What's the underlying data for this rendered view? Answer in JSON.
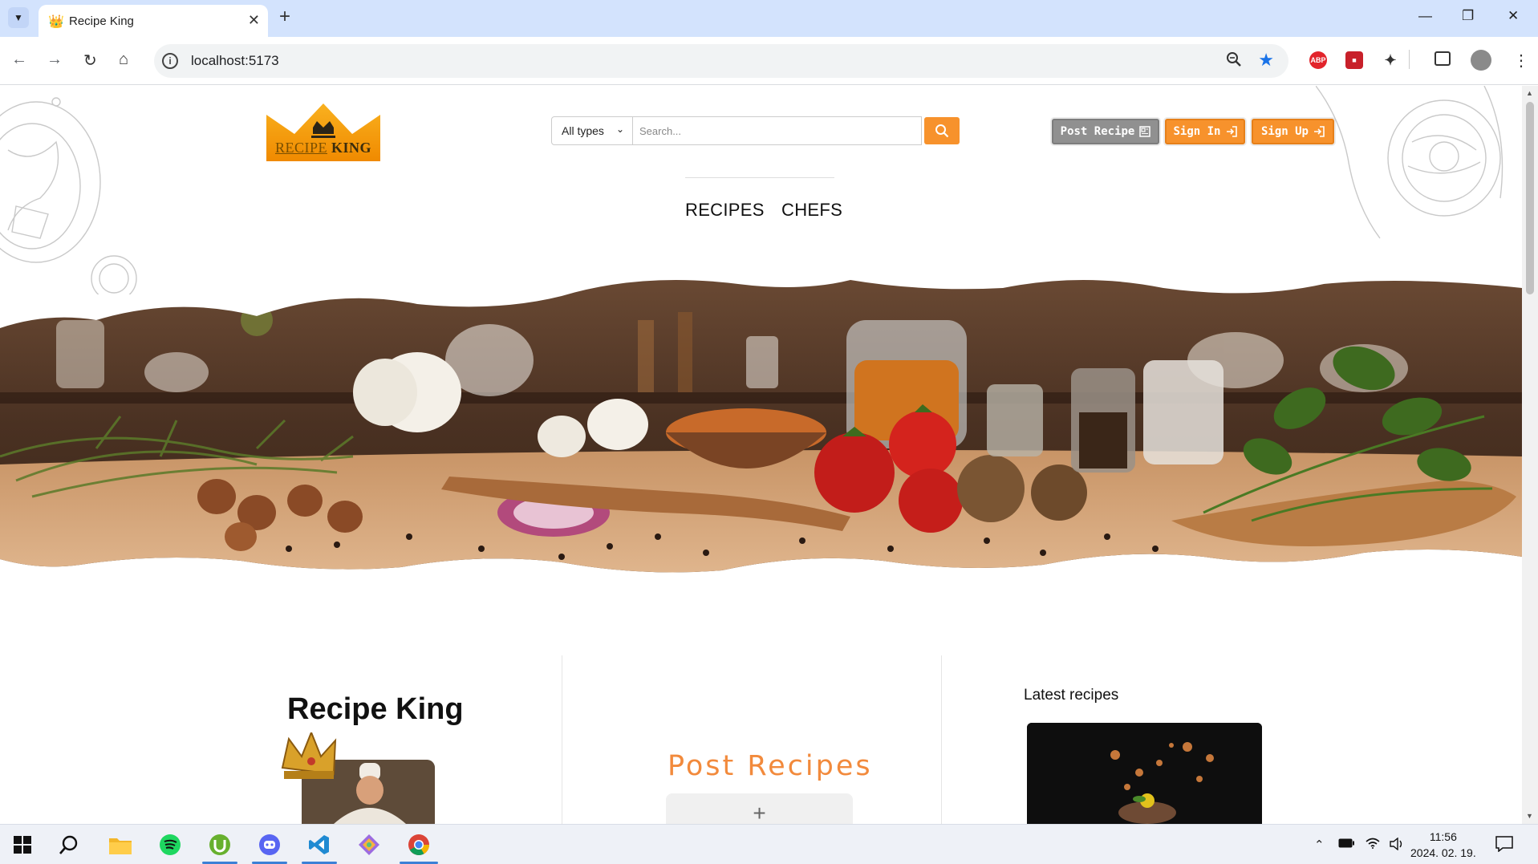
{
  "browser": {
    "tab_title": "Recipe King",
    "url": "localhost:5173",
    "extension_abp": "ABP"
  },
  "header": {
    "logo_text_left": "RECIPE",
    "logo_text_right": "KING",
    "type_select_value": "All types",
    "search_placeholder": "Search...",
    "post_recipe_label": "Post Recipe",
    "sign_in_label": "Sign In",
    "sign_up_label": "Sign Up"
  },
  "nav": {
    "items": [
      {
        "label": "RECIPES"
      },
      {
        "label": "CHEFS"
      }
    ]
  },
  "sections": {
    "brand_heading": "Recipe King",
    "post_heading": "Post Recipes",
    "post_add_symbol": "+",
    "latest_heading": "Latest recipes"
  },
  "taskbar": {
    "time": "11:56",
    "date": "2024. 02. 19."
  },
  "colors": {
    "accent_orange": "#f7922c",
    "post_heading_orange": "#f28a3c",
    "chrome_blue": "#d3e3fd",
    "button_gray": "#909090"
  }
}
